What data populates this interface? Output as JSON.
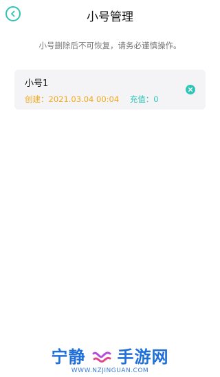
{
  "header": {
    "title": "小号管理",
    "back_icon": "chevron-left-icon"
  },
  "notice": "小号删除后不可恢复，请务必谨慎操作。",
  "accounts": [
    {
      "name": "小号1",
      "created": "创建：2021.03.04 00:04",
      "recharge": "充值：0",
      "delete_icon": "close-icon"
    }
  ],
  "watermark": {
    "left": "宁静",
    "right": "手游网",
    "url": "WWW.NZJINGUAN.COM"
  },
  "colors": {
    "accent": "#2ec4b6",
    "created": "#f2a81b",
    "card_bg": "#f4f4f6",
    "watermark": "#1e6fd9"
  }
}
